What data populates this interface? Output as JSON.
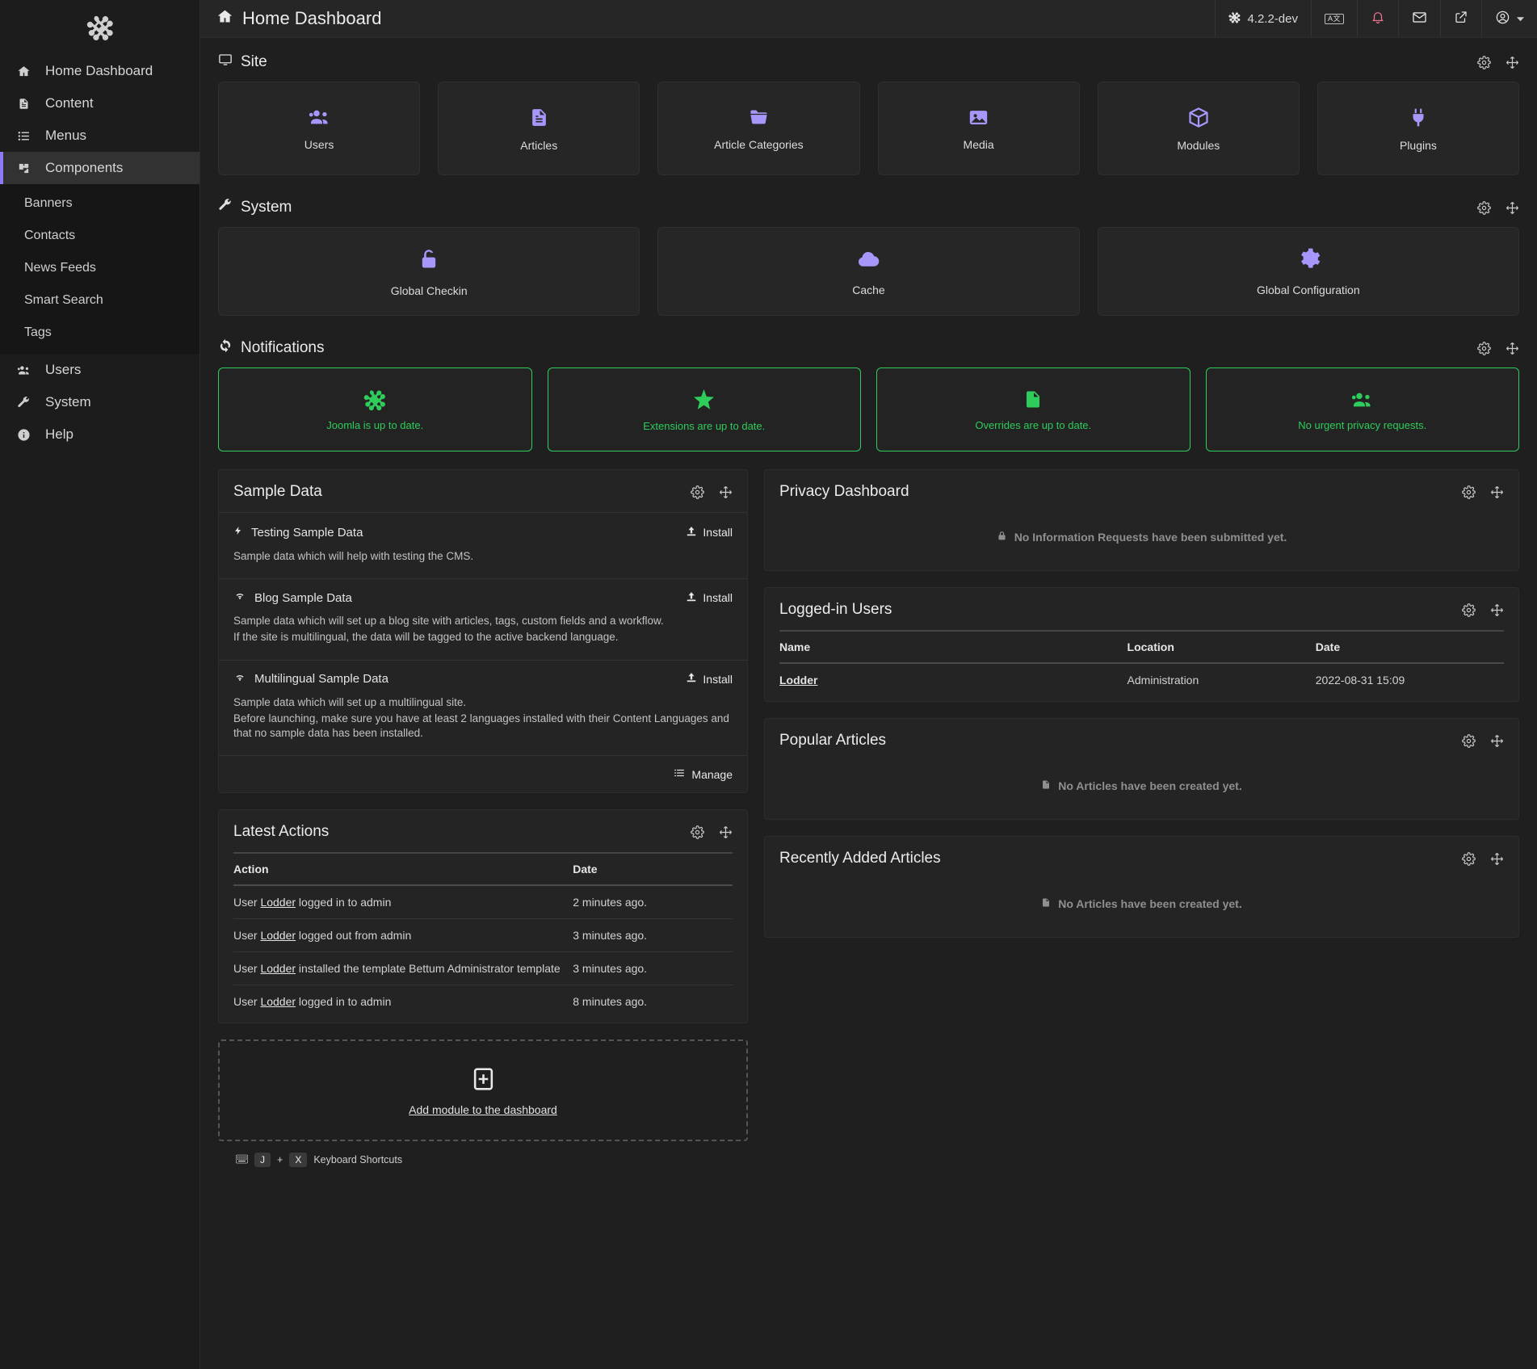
{
  "sidebar": {
    "logo": "joomla-logo",
    "items": [
      {
        "label": "Home Dashboard",
        "icon": "home-icon",
        "active": false
      },
      {
        "label": "Content",
        "icon": "document-icon",
        "active": false
      },
      {
        "label": "Menus",
        "icon": "list-icon",
        "active": false
      },
      {
        "label": "Components",
        "icon": "puzzle-icon",
        "active": true
      }
    ],
    "subitems": [
      {
        "label": "Banners"
      },
      {
        "label": "Contacts"
      },
      {
        "label": "News Feeds"
      },
      {
        "label": "Smart Search"
      },
      {
        "label": "Tags"
      }
    ],
    "items_after": [
      {
        "label": "Users",
        "icon": "users-icon"
      },
      {
        "label": "System",
        "icon": "wrench-icon"
      },
      {
        "label": "Help",
        "icon": "info-icon"
      }
    ]
  },
  "topbar": {
    "title": "Home Dashboard",
    "title_icon": "home-icon",
    "version": "4.2.2-dev",
    "version_icon": "joomla-icon",
    "translate_label": "A文",
    "icons": [
      "translate-icon",
      "bell-icon",
      "envelope-icon",
      "external-link-icon",
      "user-avatar-icon"
    ]
  },
  "site": {
    "heading": "Site",
    "heading_icon": "monitor-icon",
    "tools": [
      "gear-icon",
      "move-icon"
    ],
    "tiles": [
      {
        "label": "Users",
        "icon": "users-icon"
      },
      {
        "label": "Articles",
        "icon": "article-icon"
      },
      {
        "label": "Article Categories",
        "icon": "folder-icon"
      },
      {
        "label": "Media",
        "icon": "image-icon"
      },
      {
        "label": "Modules",
        "icon": "cube-icon"
      },
      {
        "label": "Plugins",
        "icon": "plug-icon"
      }
    ]
  },
  "system": {
    "heading": "System",
    "heading_icon": "wrench-icon",
    "tools": [
      "gear-icon",
      "move-icon"
    ],
    "tiles": [
      {
        "label": "Global Checkin",
        "icon": "lock-open-icon"
      },
      {
        "label": "Cache",
        "icon": "cloud-icon"
      },
      {
        "label": "Global Configuration",
        "icon": "gear-icon"
      }
    ]
  },
  "notifications": {
    "heading": "Notifications",
    "heading_icon": "refresh-icon",
    "tools": [
      "gear-icon",
      "move-icon"
    ],
    "color": "#2ecc5b",
    "cards": [
      {
        "text": "Joomla is up to date.",
        "icon": "joomla-icon"
      },
      {
        "text": "Extensions are up to date.",
        "icon": "star-icon"
      },
      {
        "text": "Overrides are up to date.",
        "icon": "file-icon"
      },
      {
        "text": "No urgent privacy requests.",
        "icon": "users-icon"
      }
    ]
  },
  "sample_data": {
    "title": "Sample Data",
    "tools": [
      "gear-icon",
      "move-icon"
    ],
    "items": [
      {
        "name": "Testing Sample Data",
        "icon": "bolt-icon",
        "install_label": "Install",
        "desc": "Sample data which will help with testing the CMS."
      },
      {
        "name": "Blog Sample Data",
        "icon": "wifi-icon",
        "install_label": "Install",
        "desc": "Sample data which will set up a blog site with articles, tags, custom fields and a workflow.",
        "desc2": "If the site is multilingual, the data will be tagged to the active backend language."
      },
      {
        "name": "Multilingual Sample Data",
        "icon": "wifi-icon",
        "install_label": "Install",
        "desc": "Sample data which will set up a multilingual site.",
        "desc2": "Before launching, make sure you have at least 2 languages installed with their Content Languages and that no sample data has been installed."
      }
    ],
    "manage_label": "Manage",
    "manage_icon": "list-icon"
  },
  "latest_actions": {
    "title": "Latest Actions",
    "tools": [
      "gear-icon",
      "move-icon"
    ],
    "columns": [
      "Action",
      "Date"
    ],
    "rows": [
      {
        "prefix": "User ",
        "user": "Lodder",
        "suffix": " logged in to admin",
        "date": "2 minutes ago."
      },
      {
        "prefix": "User ",
        "user": "Lodder",
        "suffix": " logged out from admin",
        "date": "3 minutes ago."
      },
      {
        "prefix": "User ",
        "user": "Lodder",
        "suffix": " installed the template Bettum Administrator template",
        "date": "3 minutes ago."
      },
      {
        "prefix": "User ",
        "user": "Lodder",
        "suffix": " logged in to admin",
        "date": "8 minutes ago."
      }
    ]
  },
  "privacy_dashboard": {
    "title": "Privacy Dashboard",
    "tools": [
      "gear-icon",
      "move-icon"
    ],
    "empty_text": "No Information Requests have been submitted yet.",
    "empty_icon": "lock-icon"
  },
  "logged_in_users": {
    "title": "Logged-in Users",
    "tools": [
      "gear-icon",
      "move-icon"
    ],
    "columns": [
      "Name",
      "Location",
      "Date"
    ],
    "rows": [
      {
        "name": "Lodder",
        "location": "Administration",
        "date": "2022-08-31 15:09"
      }
    ]
  },
  "popular_articles": {
    "title": "Popular Articles",
    "tools": [
      "gear-icon",
      "move-icon"
    ],
    "empty_text": "No Articles have been created yet.",
    "empty_icon": "article-icon"
  },
  "recently_added_articles": {
    "title": "Recently Added Articles",
    "tools": [
      "gear-icon",
      "move-icon"
    ],
    "empty_text": "No Articles have been created yet.",
    "empty_icon": "article-icon"
  },
  "add_module": {
    "label": "Add module to the dashboard",
    "icon": "plus-box-icon"
  },
  "footer": {
    "icon": "keyboard-icon",
    "key1": "J",
    "plus": "+",
    "key2": "X",
    "label": "Keyboard Shortcuts"
  }
}
